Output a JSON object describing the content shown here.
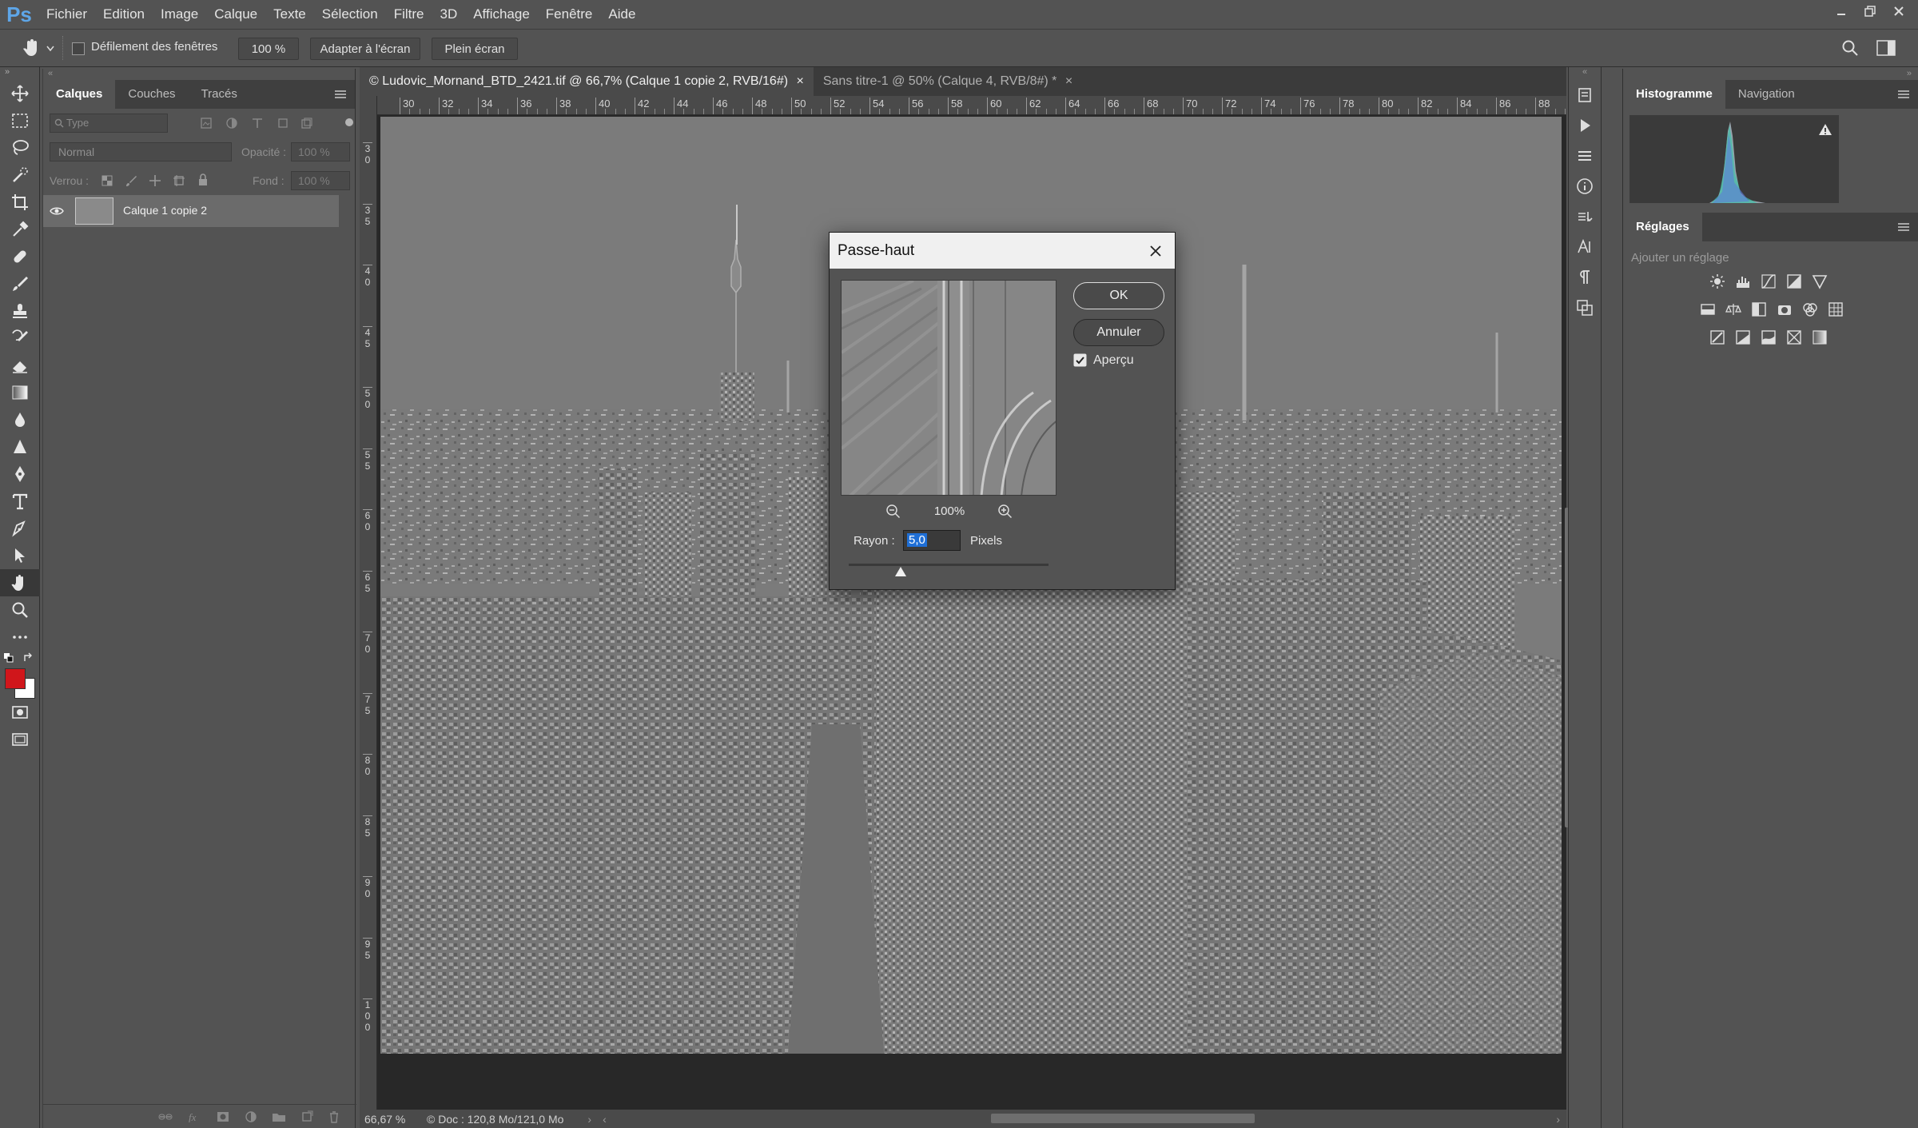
{
  "app": {
    "logo": "Ps"
  },
  "menu": [
    "Fichier",
    "Edition",
    "Image",
    "Calque",
    "Texte",
    "Sélection",
    "Filtre",
    "3D",
    "Affichage",
    "Fenêtre",
    "Aide"
  ],
  "options": {
    "scroll_all_label": "Défilement des fenêtres",
    "zoom_value": "100 %",
    "fit_label": "Adapter à l'écran",
    "fullscreen_label": "Plein écran"
  },
  "layers_panel": {
    "tabs": [
      "Calques",
      "Couches",
      "Tracés"
    ],
    "filter_placeholder": "Type",
    "blend_mode": "Normal",
    "opacity_label": "Opacité :",
    "opacity_value": "100 %",
    "lock_label": "Verrou :",
    "fill_label": "Fond :",
    "fill_value": "100 %",
    "layer_name": "Calque 1 copie 2"
  },
  "documents": {
    "tabs": [
      "© Ludovic_Mornand_BTD_2421.tif @ 66,7% (Calque 1 copie 2, RVB/16#)",
      "Sans titre-1 @ 50% (Calque 4, RVB/8#) *"
    ]
  },
  "ruler": {
    "h_ticks": [
      "30",
      "32",
      "34",
      "36",
      "38",
      "40",
      "42",
      "44",
      "46",
      "48",
      "50",
      "52",
      "54",
      "56",
      "58",
      "60",
      "62",
      "64",
      "66",
      "68",
      "70",
      "72",
      "74",
      "76",
      "78",
      "80",
      "82",
      "84",
      "86",
      "88"
    ],
    "v_ticks": [
      "3",
      "3",
      "4",
      "4",
      "5",
      "5",
      "6",
      "6",
      "7",
      "7",
      "8",
      "8",
      "9",
      "9",
      "1"
    ],
    "v_ticks_2": [
      "0",
      "5",
      "0",
      "5",
      "0",
      "5",
      "0",
      "5",
      "0",
      "5",
      "0",
      "5",
      "0",
      "5",
      "0"
    ],
    "v_ticks_3": [
      "",
      "",
      "",
      "",
      "",
      "",
      "",
      "",
      "",
      "",
      "",
      "",
      "",
      "",
      "0"
    ]
  },
  "status": {
    "zoom": "66,67 %",
    "doc_info": "© Doc : 120,8 Mo/121,0 Mo"
  },
  "right_panels": {
    "top_tabs": [
      "Histogramme",
      "Navigation"
    ],
    "adjust_title": "Réglages",
    "adjust_hint": "Ajouter un réglage"
  },
  "dialog": {
    "title": "Passe-haut",
    "ok_label": "OK",
    "cancel_label": "Annuler",
    "preview_label": "Aperçu",
    "preview_checked": true,
    "zoom_value": "100%",
    "radius_label": "Rayon :",
    "radius_value": "5,0",
    "radius_unit": "Pixels"
  },
  "colors": {
    "foreground": "#d0161b",
    "background": "#ffffff",
    "accent": "#1f6fd6"
  }
}
